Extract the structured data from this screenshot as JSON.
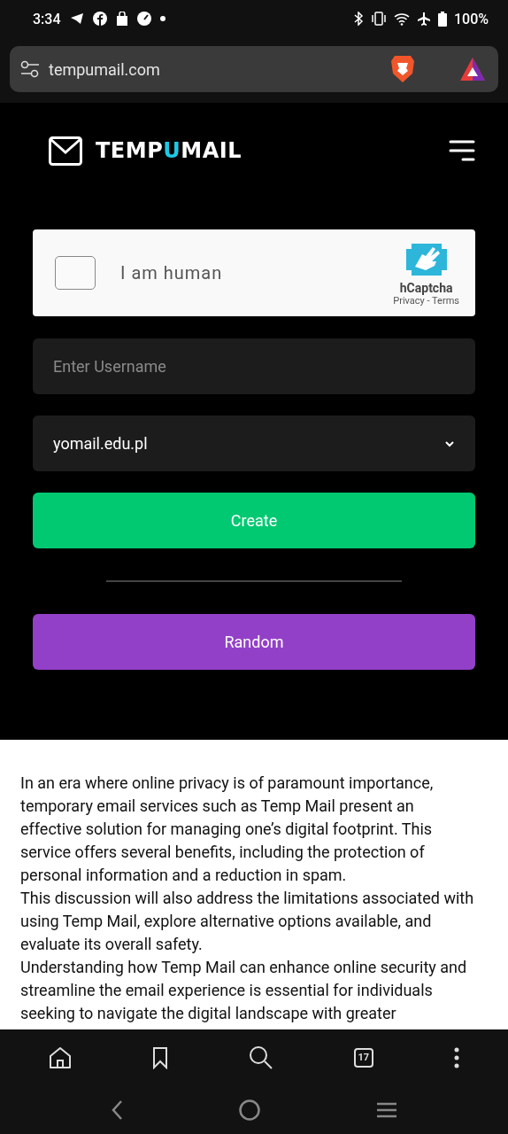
{
  "status_bar": {
    "time": "3:34",
    "battery": "100%"
  },
  "address_bar": {
    "url": "tempumail.com"
  },
  "header": {
    "logo": [
      {
        "text": "TEMP",
        "accent": false
      },
      {
        "text": "U",
        "accent": true
      },
      {
        "text": "MAIL",
        "accent": false
      }
    ]
  },
  "captcha": {
    "label": "I am human",
    "checked": false,
    "brand": "hCaptcha",
    "links": "Privacy - Terms"
  },
  "username": {
    "placeholder": "Enter Username"
  },
  "domain": {
    "value": "yomail.edu.pl"
  },
  "buttons": [
    {
      "label": "Create",
      "kind": "create"
    },
    {
      "label": "Random",
      "kind": "random"
    }
  ],
  "article": {
    "paragraphs": [
      "In an era where online privacy is of paramount importance, temporary email services such as Temp Mail present an effective solution for managing one’s digital footprint. This service offers several benefits, including the protection of personal information and a reduction in spam.",
      "This discussion will also address the limitations associated with using Temp Mail, explore alternative options available, and evaluate its overall safety.",
      "Understanding how Temp Mail can enhance online security and streamline the email experience is essential for individuals seeking to navigate the digital landscape with greater"
    ]
  },
  "toolbar": {
    "tab_count": "17"
  }
}
